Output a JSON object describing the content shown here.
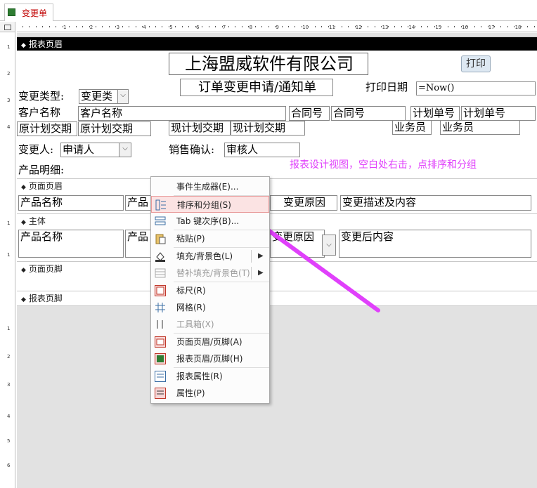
{
  "tab": {
    "label": "变更单"
  },
  "ruler": {
    "h_labels": [
      "1",
      "2",
      "3",
      "4",
      "5",
      "6",
      "7",
      "8",
      "9",
      "10",
      "11",
      "12",
      "13",
      "14",
      "15",
      "16",
      "17",
      "18",
      "19"
    ],
    "v_labels": [
      "1",
      "2",
      "3",
      "4",
      "1",
      "1",
      "1",
      "2",
      "3",
      "4",
      "5",
      "6"
    ]
  },
  "sections": {
    "report_header": "报表页眉",
    "page_header": "页面页眉",
    "detail": "主体",
    "page_footer": "页面页脚",
    "report_footer": "报表页脚"
  },
  "header": {
    "company": "上海盟威软件有限公司",
    "print_button": "打印",
    "subtitle": "订单变更申请/通知单",
    "print_date_label": "打印日期",
    "print_date_value": "=Now()",
    "change_type_label": "变更类型:",
    "change_type_value": "变更类",
    "customer_label": "客户名称",
    "customer_value": "客户名称",
    "contract_label": "合同号",
    "contract_value": "合同号",
    "plan_no_label": "计划单号",
    "plan_no_value": "计划单号",
    "orig_delivery_label": "原计划交期",
    "orig_delivery_value": "原计划交期",
    "curr_delivery_label": "现计划交期",
    "curr_delivery_value": "现计划交期",
    "sales_label": "业务员",
    "sales_value": "业务员",
    "changer_label": "变更人:",
    "changer_value": "申请人",
    "sales_confirm_label": "销售确认:",
    "sales_confirm_value": "审核人",
    "product_detail_label": "产品明细:"
  },
  "annotation": "报表设计视图，空白处右击，点排序和分组",
  "page_header_fields": [
    "产品名称",
    "产品",
    "变更原因",
    "变更描述及内容"
  ],
  "detail_fields": [
    "产品名称",
    "产品",
    "变更原因",
    "变更后内容"
  ],
  "context_menu": [
    {
      "label": "事件生成器(E)...",
      "icon": "event-builder-icon",
      "disabled": false
    },
    {
      "label": "排序和分组(S)",
      "icon": "sort-group-icon",
      "disabled": false,
      "highlight": true
    },
    {
      "label": "Tab 键次序(B)...",
      "icon": "tab-order-icon",
      "disabled": false
    },
    {
      "label": "粘贴(P)",
      "icon": "paste-icon",
      "disabled": false
    },
    {
      "label": "填充/背景色(L)",
      "icon": "fill-color-icon",
      "disabled": false,
      "submenu": true
    },
    {
      "label": "替补填充/背景色(T)",
      "icon": "alt-fill-color-icon",
      "disabled": true,
      "submenu": true
    },
    {
      "label": "标尺(R)",
      "icon": "ruler-icon",
      "disabled": false
    },
    {
      "label": "网格(R)",
      "icon": "grid-icon",
      "disabled": false
    },
    {
      "label": "工具箱(X)",
      "icon": "toolbox-icon",
      "disabled": true
    },
    {
      "label": "页面页眉/页脚(A)",
      "icon": "page-header-footer-icon",
      "disabled": false
    },
    {
      "label": "报表页眉/页脚(H)",
      "icon": "report-header-footer-icon",
      "disabled": false
    },
    {
      "label": "报表属性(R)",
      "icon": "report-properties-icon",
      "disabled": false
    },
    {
      "label": "属性(P)",
      "icon": "properties-icon",
      "disabled": false
    }
  ],
  "colors": {
    "annotation": "#e040fb",
    "arrow": "#e040fb",
    "tab_text": "#c00000"
  }
}
